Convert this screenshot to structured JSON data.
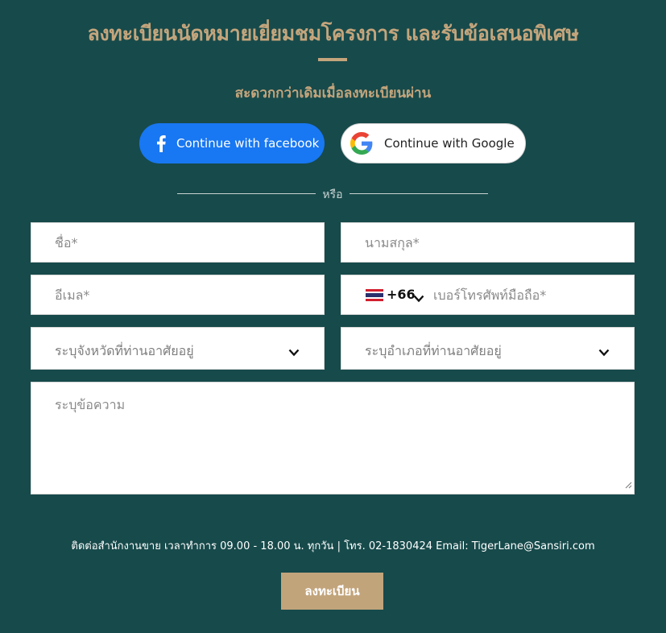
{
  "header": {
    "title": "ลงทะเบียนนัดหมายเยี่ยมชมโครงการ และรับข้อเสนอพิเศษ",
    "subtitle": "สะดวกกว่าเดิมเมื่อลงทะเบียนผ่าน"
  },
  "social": {
    "facebook_label": "Continue with facebook",
    "facebook_icon": "facebook-icon",
    "facebook_color": "#1877f2",
    "google_label": "Continue with Google",
    "google_icon": "google-icon"
  },
  "divider": {
    "text": "หรือ"
  },
  "form": {
    "first_name": {
      "placeholder": "ชื่อ*",
      "value": ""
    },
    "last_name": {
      "placeholder": "นามสกุล*",
      "value": ""
    },
    "email": {
      "placeholder": "อีเมล*",
      "value": ""
    },
    "phone": {
      "country_code": "+66",
      "placeholder": "เบอร์โทรศัพท์มือถือ*",
      "value": "",
      "flag_icon": "thailand-flag-icon"
    },
    "province": {
      "selected": "ระบุจังหวัดที่ท่านอาศัยอยู่"
    },
    "district": {
      "selected": "ระบุอำเภอที่ท่านอาศัยอยู่"
    },
    "message": {
      "placeholder": "ระบุข้อความ",
      "value": ""
    }
  },
  "footer": {
    "contact": "ติดต่อสำนักงานขาย เวลาทำการ 09.00 - 18.00 น. ทุกวัน | โทร. 02-1830424 Email: TigerLane@Sansiri.com",
    "submit_label": "ลงทะเบียน"
  },
  "colors": {
    "background": "#174a4b",
    "accent": "#c4a57c",
    "submit": "#c2a47b"
  }
}
